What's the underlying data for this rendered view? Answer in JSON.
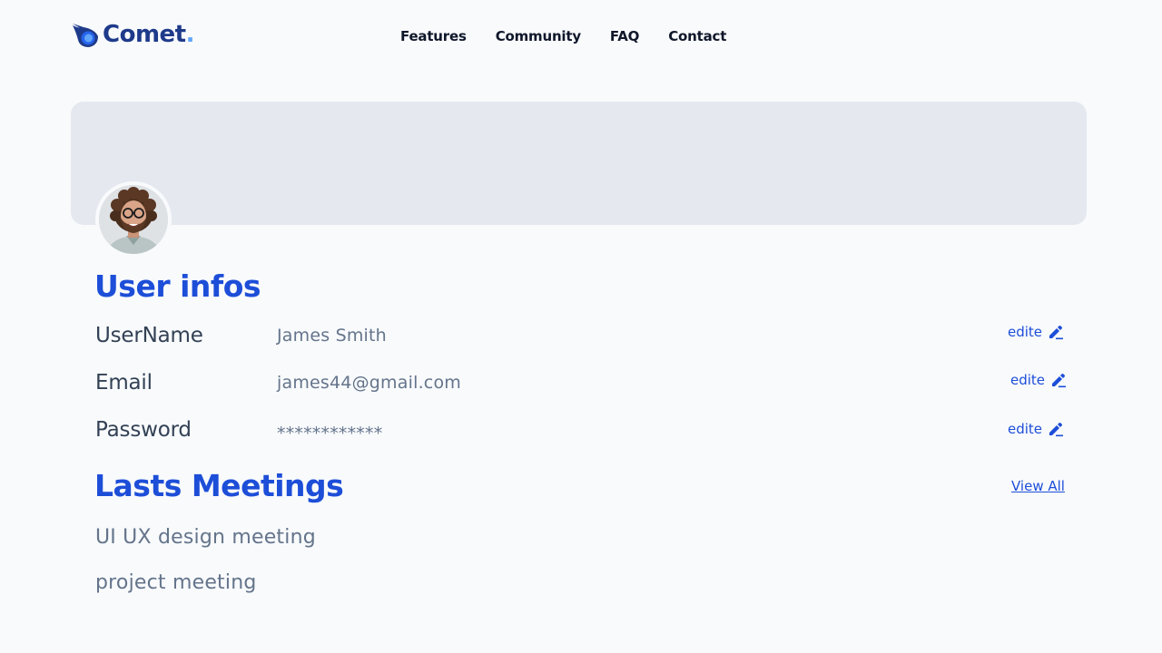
{
  "brand": {
    "name": "Comet",
    "dot": ".",
    "primary_color": "#1e3a8a",
    "accent_color": "#60a5fa"
  },
  "nav": {
    "items": [
      {
        "label": "Features"
      },
      {
        "label": "Community"
      },
      {
        "label": "FAQ"
      },
      {
        "label": "Contact"
      }
    ]
  },
  "profile": {
    "avatar_icon": "user-avatar-photo",
    "section_title": "User infos",
    "fields": [
      {
        "label": "UserName",
        "value": "James Smith",
        "edit_label": "edite",
        "edit_icon": "pencil-icon"
      },
      {
        "label": "Email",
        "value": "james44@gmail.com",
        "edit_label": "edite",
        "edit_icon": "pencil-icon"
      },
      {
        "label": "Password",
        "value": "************",
        "edit_label": "edite",
        "edit_icon": "pencil-icon"
      }
    ]
  },
  "meetings": {
    "section_title": "Lasts Meetings",
    "view_all_label": "View All",
    "items": [
      {
        "title": "UI UX design meeting"
      },
      {
        "title": "project meeting"
      }
    ]
  },
  "colors": {
    "heading": "#1d4ed8",
    "banner": "#e5e9ef",
    "background": "#f8fafc"
  }
}
